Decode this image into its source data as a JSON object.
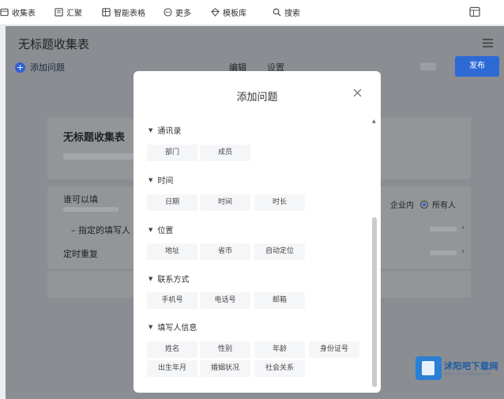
{
  "toolbar": {
    "items": [
      "收集表",
      "汇聚",
      "智能表格",
      "更多",
      "模板库",
      "搜索"
    ]
  },
  "app": {
    "form_title": "无标题收集表",
    "add_question": "添加问题",
    "tab_edit": "编辑",
    "tab_settings": "设置",
    "publish": "发布",
    "card_title": "无标题收集表",
    "who_can_fill": "谁可以填",
    "specify_fillers": "指定的填写人",
    "scheduled_repeat": "定时重复",
    "scope_enterprise": "企业内",
    "scope_everyone": "所有人"
  },
  "modal": {
    "title": "添加问题",
    "sections": [
      {
        "title": "通讯录",
        "chips": [
          "部门",
          "成员"
        ]
      },
      {
        "title": "时间",
        "chips": [
          "日期",
          "时间",
          "时长"
        ]
      },
      {
        "title": "位置",
        "chips": [
          "地址",
          "省市",
          "自动定位"
        ]
      },
      {
        "title": "联系方式",
        "chips": [
          "手机号",
          "电话号",
          "邮箱"
        ]
      },
      {
        "title": "填写人信息",
        "chips": [
          "姓名",
          "性别",
          "年龄",
          "身份证号",
          "出生年月",
          "婚姻状况",
          "社会关系"
        ]
      }
    ]
  },
  "watermark": {
    "cn": "沭阳吧下载网",
    "en": "WWW.SHUYANGBA.COM"
  },
  "colors": {
    "accent": "#2e6ad6",
    "overlay": "#8a8d91"
  }
}
